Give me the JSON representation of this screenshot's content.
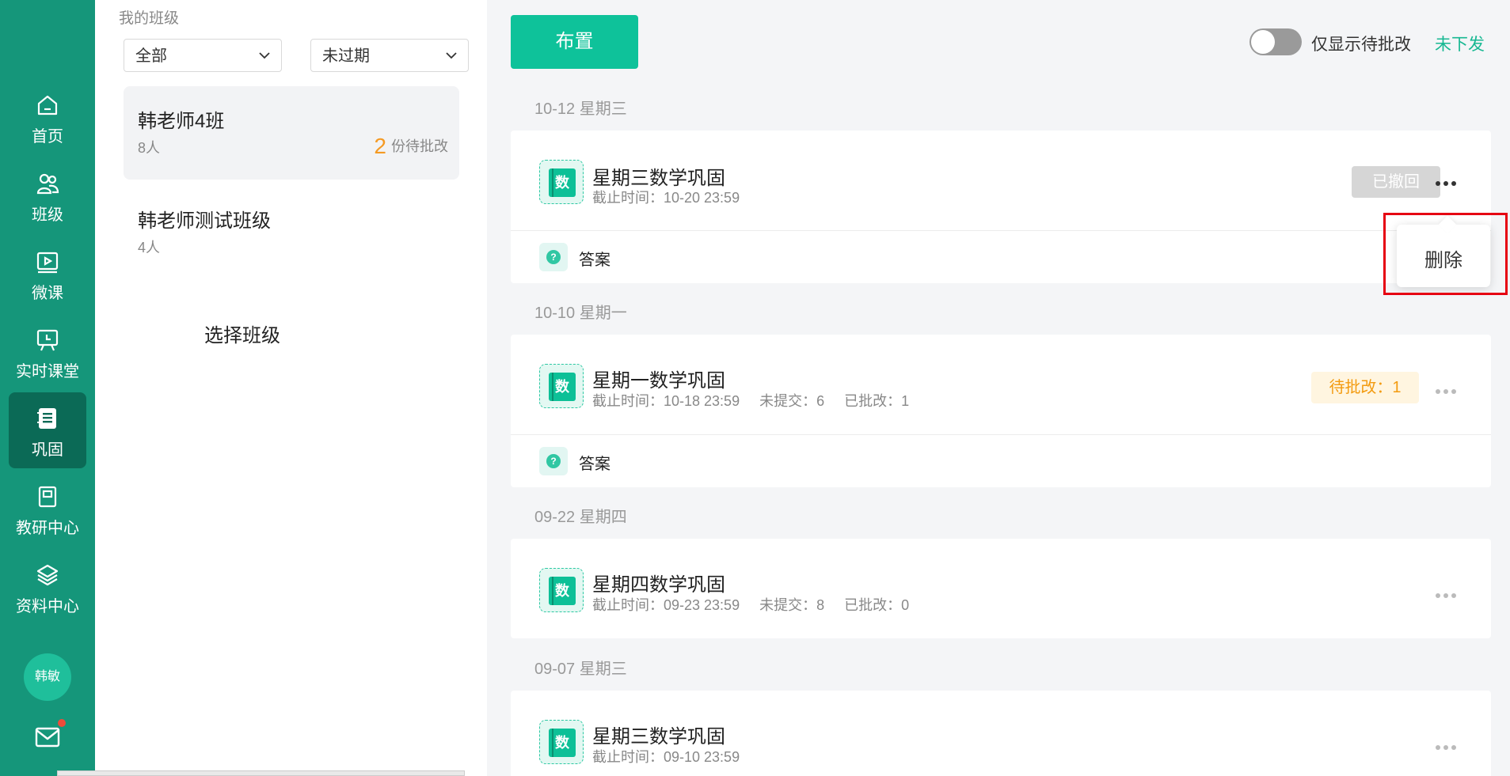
{
  "nav": {
    "items": [
      {
        "label": "首页",
        "icon": "home-icon"
      },
      {
        "label": "班级",
        "icon": "users-icon"
      },
      {
        "label": "微课",
        "icon": "video-icon"
      },
      {
        "label": "实时课堂",
        "icon": "classroom-icon"
      },
      {
        "label": "巩固",
        "icon": "notebook-icon",
        "active": true
      },
      {
        "label": "教研中心",
        "icon": "book-icon"
      },
      {
        "label": "资料中心",
        "icon": "layers-icon"
      }
    ],
    "avatar": "韩敏"
  },
  "class_panel": {
    "title": "我的班级",
    "filter_scope": "全部",
    "filter_status": "未过期",
    "classes": [
      {
        "name": "韩老师4班",
        "count": "8人",
        "pending_num": "2",
        "pending_label": "份待批改"
      },
      {
        "name": "韩老师测试班级",
        "count": "4人"
      }
    ],
    "hint": "选择班级"
  },
  "toolbar": {
    "assign_label": "布置",
    "toggle_label": "仅显示待批改",
    "undelivered_label": "未下发"
  },
  "groups": [
    {
      "date": "10-12 星期三",
      "title": "星期三数学巩固",
      "meta": "截止时间：10-20 23:59",
      "badge": "已撤回",
      "answer": "答案"
    },
    {
      "date": "10-10 星期一",
      "title": "星期一数学巩固",
      "meta": "截止时间：10-18 23:59     未提交：6     已批改：1",
      "badge": "待批改：1",
      "answer": "答案"
    },
    {
      "date": "09-22 星期四",
      "title": "星期四数学巩固",
      "meta": "截止时间：09-23 23:59     未提交：8     已批改：0"
    },
    {
      "date": "09-07 星期三",
      "title": "星期三数学巩固",
      "meta": "截止时间：09-10 23:59"
    }
  ],
  "subject_glyph": "数",
  "popover": {
    "delete_label": "删除"
  },
  "colors": {
    "nav": "#15967a",
    "accent": "#0ec29a",
    "pending": "#f39b10",
    "highlight": "#e60012"
  }
}
